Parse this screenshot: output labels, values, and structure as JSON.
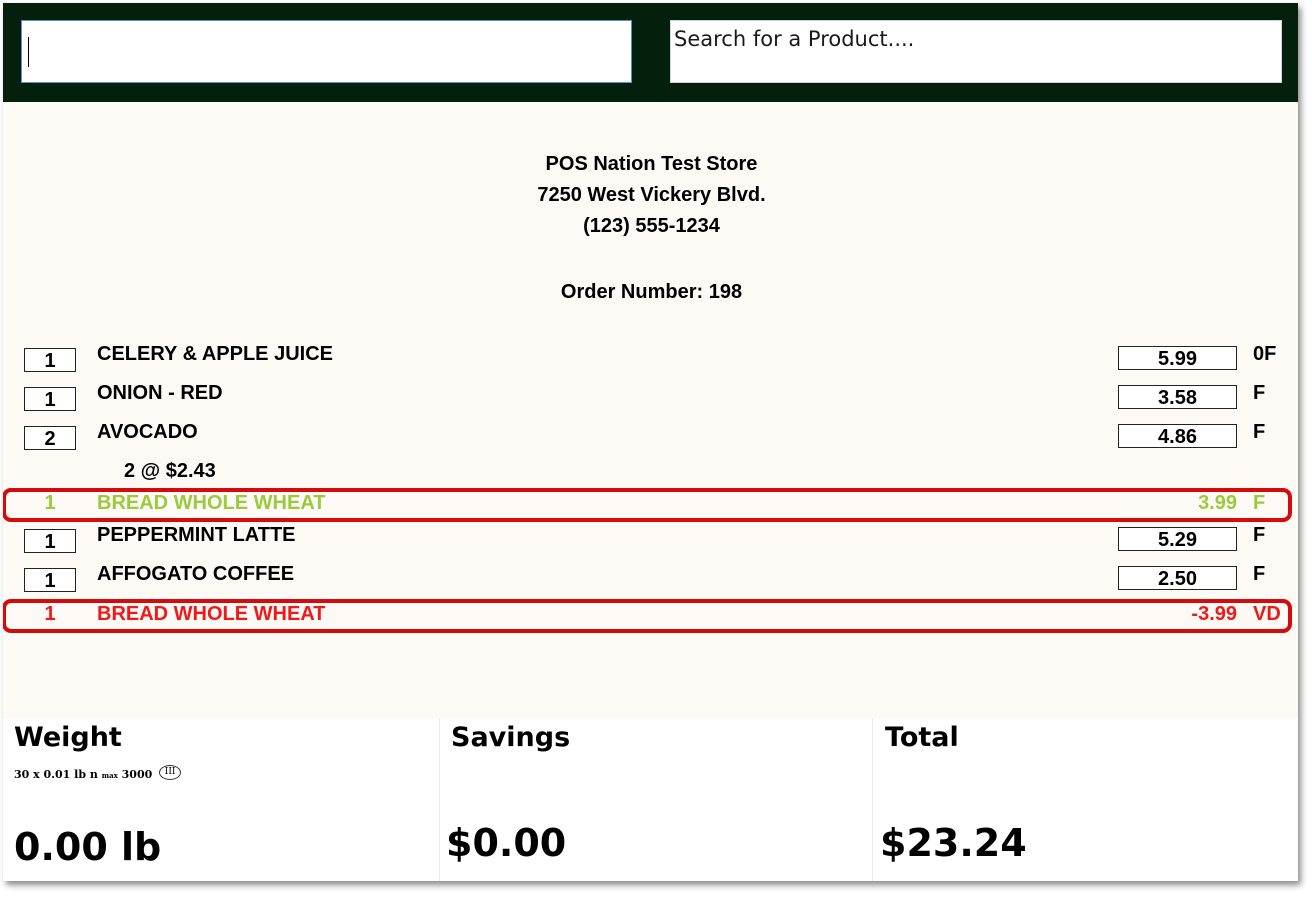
{
  "search": {
    "scan_value": "",
    "placeholder": "Search for a Product...."
  },
  "store": {
    "name": "POS Nation Test Store",
    "address": "7250 West Vickery Blvd.",
    "phone": "(123) 555-1234"
  },
  "order": {
    "label": "Order Number: 198"
  },
  "items": [
    {
      "qty": "1",
      "name": "CELERY & APPLE JUICE",
      "price": "5.99",
      "flag": "0F"
    },
    {
      "qty": "1",
      "name": "ONION - RED",
      "price": "3.58",
      "flag": "F"
    },
    {
      "qty": "2",
      "name": "AVOCADO",
      "price": "4.86",
      "flag": "F",
      "note": "2 @ $2.43"
    },
    {
      "qty": "1",
      "name": "BREAD WHOLE WHEAT",
      "price": "3.99",
      "flag": "F",
      "status": "highlighted",
      "color": "#9acb3c"
    },
    {
      "qty": "1",
      "name": "PEPPERMINT LATTE",
      "price": "5.29",
      "flag": "F"
    },
    {
      "qty": "1",
      "name": "AFFOGATO COFFEE",
      "price": "2.50",
      "flag": "F"
    },
    {
      "qty": "1",
      "name": "BREAD WHOLE WHEAT",
      "price": "-3.99",
      "flag": "VD",
      "status": "void",
      "color": "#f01818"
    }
  ],
  "totals": {
    "weight": {
      "label": "Weight",
      "spec_main": "30 x 0.01 lb n",
      "spec_sub": "max",
      "spec_max": "3000",
      "spec_class": "III",
      "value": "0.00 lb"
    },
    "savings": {
      "label": "Savings",
      "value": "$0.00"
    },
    "total": {
      "label": "Total",
      "value": "$23.24"
    }
  },
  "colors": {
    "header_bg": "#03200d",
    "receipt_bg": "#fdf9f5",
    "highlight_item": "#9acb3c",
    "void_item": "#f01818",
    "annotation_border": "#d50a0a"
  }
}
